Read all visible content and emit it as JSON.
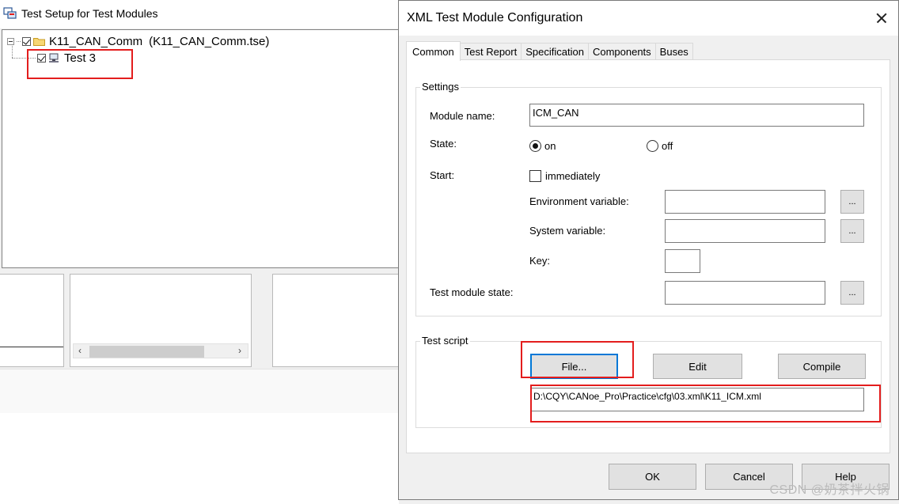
{
  "background_window": {
    "title": "Test Setup for Test Modules",
    "tree": {
      "root": {
        "label": "K11_CAN_Comm",
        "file": "(K11_CAN_Comm.tse)",
        "checked": true
      },
      "child": {
        "label": "Test 3",
        "checked": true
      }
    }
  },
  "dialog": {
    "title": "XML Test Module Configuration",
    "tabs": [
      {
        "label": "Common",
        "active": true
      },
      {
        "label": "Test Report",
        "active": false
      },
      {
        "label": "Specification",
        "active": false
      },
      {
        "label": "Components",
        "active": false
      },
      {
        "label": "Buses",
        "active": false
      }
    ],
    "settings": {
      "group_label": "Settings",
      "module_name_label": "Module name:",
      "module_name_value": "ICM_CAN",
      "state_label": "State:",
      "state_on": "on",
      "state_off": "off",
      "state_selected": "on",
      "start_label": "Start:",
      "immediately_label": "immediately",
      "immediately_checked": false,
      "env_var_label": "Environment variable:",
      "env_var_value": "",
      "sys_var_label": "System variable:",
      "sys_var_value": "",
      "key_label": "Key:",
      "key_value": "",
      "module_state_label": "Test module state:",
      "module_state_value": "",
      "browse_label": "..."
    },
    "test_script": {
      "group_label": "Test script",
      "file_button": "File...",
      "edit_button": "Edit",
      "compile_button": "Compile",
      "path_value": "D:\\CQY\\CANoe_Pro\\Practice\\cfg\\03.xml\\K11_ICM.xml"
    },
    "footer": {
      "ok": "OK",
      "cancel": "Cancel",
      "help": "Help"
    }
  },
  "watermark": "CSDN @奶茶拌火锅",
  "colors": {
    "highlight_red": "#e31d1d",
    "focus_blue": "#0078d7"
  },
  "icons": {
    "window": "test-setup-icon",
    "folder": "folder-icon",
    "module": "test-module-icon",
    "close": "close-icon"
  }
}
